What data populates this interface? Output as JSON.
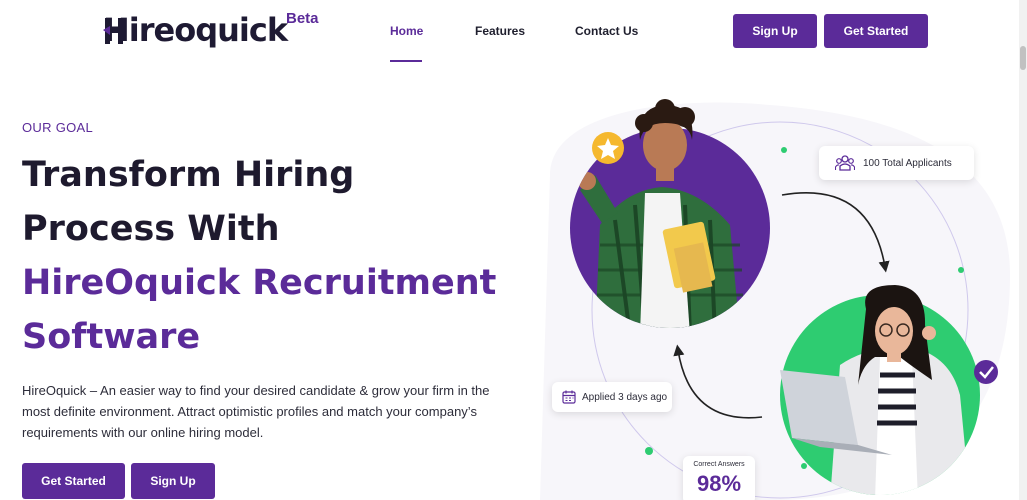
{
  "brand": {
    "logo_text": "Hireoquick",
    "beta_label": "Beta"
  },
  "nav": {
    "items": [
      {
        "label": "Home",
        "active": true
      },
      {
        "label": "Features",
        "active": false
      },
      {
        "label": "Contact Us",
        "active": false
      }
    ],
    "signup_label": "Sign Up",
    "get_started_label": "Get Started"
  },
  "hero": {
    "eyebrow": "OUR GOAL",
    "headline_line1": "Transform Hiring",
    "headline_line2": "Process With",
    "headline_line3": "HireOquick Recruitment",
    "headline_line4": "Software",
    "description": "HireOquick – An easier way to find your desired candidate & grow your firm in the most definite environment. Attract optimistic profiles and match your company’s requirements with our online hiring model.",
    "cta_primary": "Get Started",
    "cta_secondary": "Sign Up"
  },
  "illustration": {
    "applicants_card": "100 Total Applicants",
    "applied_card": "Applied 3 days ago",
    "answers_label": "Correct Answers",
    "answers_value": "98%",
    "icons": [
      "star-icon",
      "users-icon",
      "calendar-icon",
      "check-icon"
    ]
  },
  "colors": {
    "brand_purple": "#5b2b99",
    "green": "#2ecc71",
    "gold": "#f5b82e"
  }
}
